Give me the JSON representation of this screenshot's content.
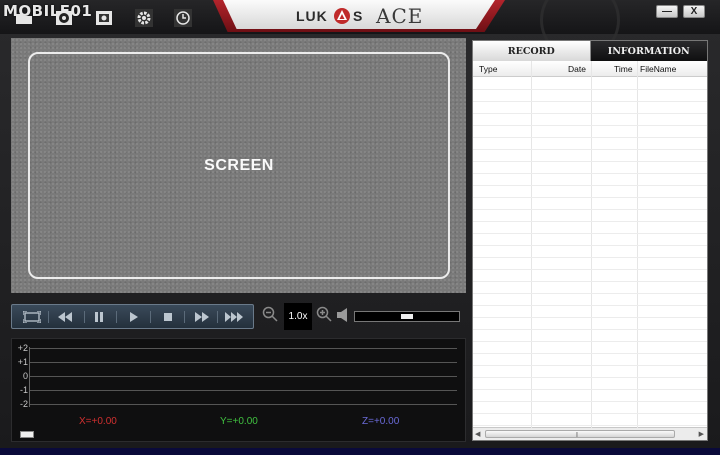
{
  "watermark": "MOBILE01",
  "brand": {
    "left": "LUK",
    "middle": "S",
    "right": "ACE"
  },
  "window_controls": {
    "minimize": "—",
    "close": "X"
  },
  "screen": {
    "label": "SCREEN"
  },
  "playback": {
    "speed": "1.0x",
    "volume_level": 0.5
  },
  "graph": {
    "y_labels": [
      "+2",
      "+1",
      "0",
      "-1",
      "-2"
    ],
    "x_readout": "X=+0.00",
    "y_readout": "Y=+0.00",
    "z_readout": "Z=+0.00",
    "colors": {
      "x": "#d03030",
      "y": "#40c040",
      "z": "#6a6ad8"
    }
  },
  "tabs": [
    {
      "label": "RECORD",
      "active": true
    },
    {
      "label": "INFORMATION",
      "active": false
    }
  ],
  "table": {
    "columns": [
      "Type",
      "Date",
      "Time",
      "FileName"
    ],
    "rows": []
  },
  "icons": [
    "folder-icon",
    "disc-icon",
    "photo-icon",
    "gear-icon",
    "clock-icon",
    "fit-screen-icon",
    "rewind-icon",
    "pause-icon",
    "play-icon",
    "stop-icon",
    "fast-forward-icon",
    "zoom-out-icon",
    "zoom-in-icon",
    "speaker-icon"
  ]
}
